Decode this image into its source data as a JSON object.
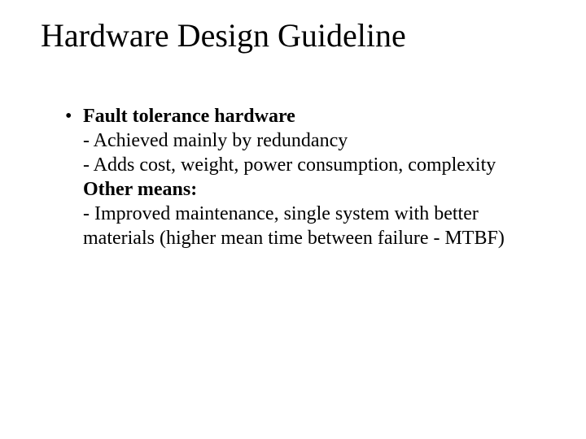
{
  "slide": {
    "title": "Hardware Design Guideline",
    "bullet_marker": "•",
    "heading1": "Fault tolerance hardware",
    "line1": "- Achieved mainly by redundancy",
    "line2": "- Adds cost, weight, power consumption, complexity",
    "heading2": "Other means:",
    "line3": "- Improved maintenance, single system with better materials (higher mean time between failure - MTBF)"
  }
}
